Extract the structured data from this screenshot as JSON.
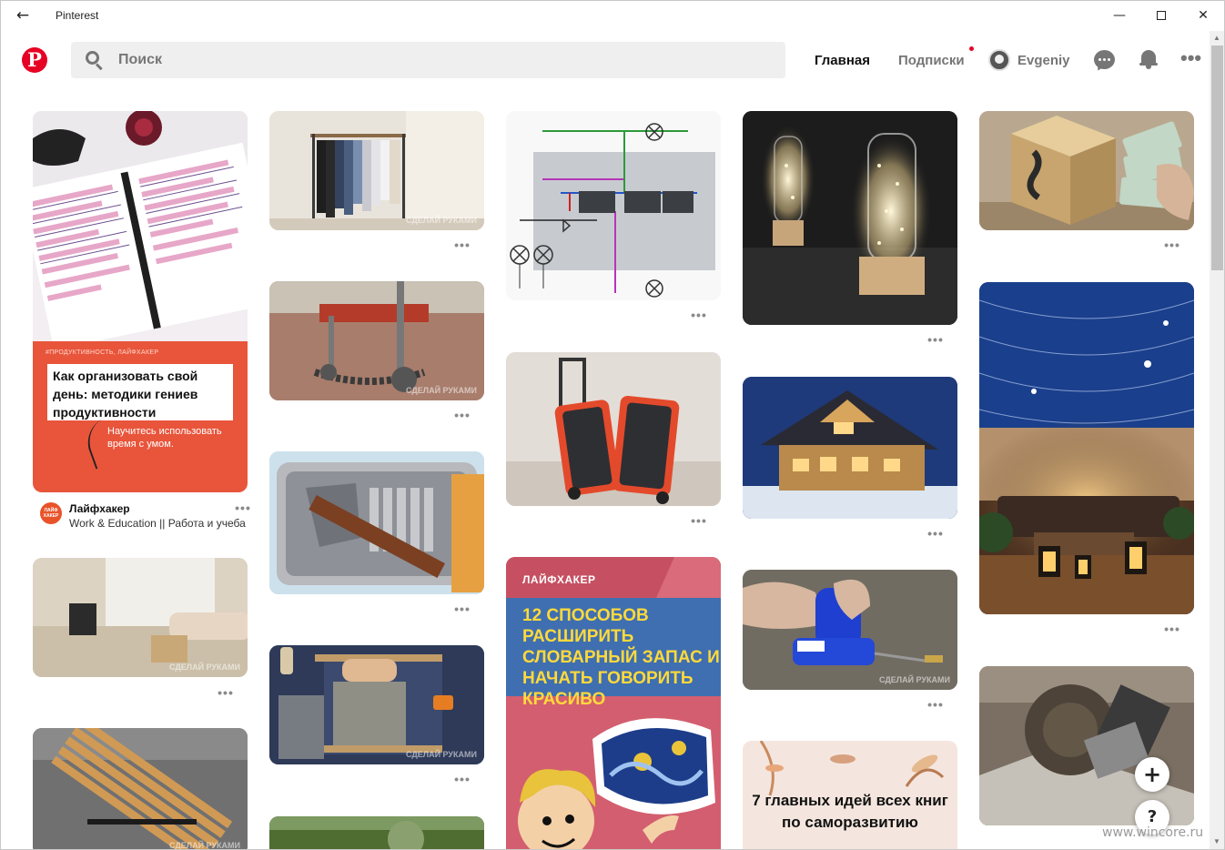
{
  "window": {
    "title": "Pinterest",
    "back": "←",
    "minimize": "—",
    "close": "✕"
  },
  "header": {
    "logo": "P",
    "search_placeholder": "Поиск",
    "nav_home": "Главная",
    "nav_subscriptions": "Подписки",
    "user_name": "Evgeniy",
    "more": "•••",
    "accent": "#e60023"
  },
  "pins": {
    "p1": {
      "tag": "#продуктивность, лайфхакер",
      "title": "Как организовать свой день: методики гениев продуктивности",
      "subtitle": "Научитесь использовать время с умом.",
      "author_avatar": "ЛАЙФ ХАКЕР",
      "author": "Лайфхакер",
      "board": "Work & Education || Работа и учеба"
    },
    "p14": {
      "brand": "ЛАЙФХАКЕР",
      "title": "12 способов расширить словарный запас и начать говорить красиво"
    },
    "p19": {
      "title": "7 главных идей всех книг по саморазвитию"
    },
    "more": "•••",
    "watermark": "СДЕЛАЙ РУКАМИ"
  },
  "fab": {
    "plus": "+",
    "help": "?"
  },
  "corner_watermark": "www.wincore.ru"
}
